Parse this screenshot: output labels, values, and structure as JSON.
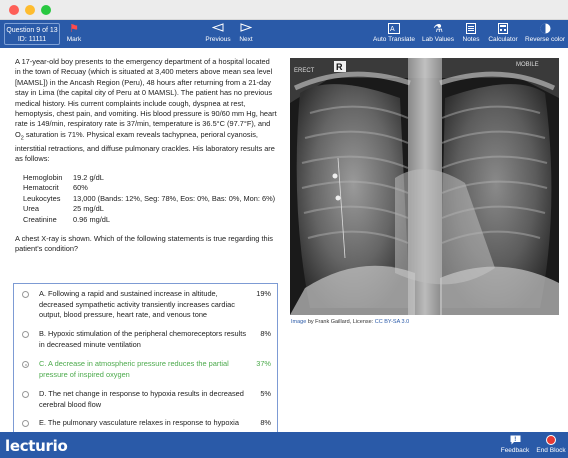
{
  "topbar": {
    "question_label": "Question 9 of 13",
    "id_label": "ID: 11111",
    "mark": "Mark",
    "prev": "Previous",
    "next": "Next",
    "auto_translate": "Auto Translate",
    "lab_values": "Lab Values",
    "notes": "Notes",
    "calculator": "Calculator",
    "reverse_color": "Reverse color"
  },
  "question": {
    "paragraph1": "A 17-year-old boy presents to the emergency department of a hospital located in the town of Recuay (which is situated at 3,400 meters above mean sea level [MAMSL]) in the Ancash Region (Peru), 48 hours after returning from a 21-day stay in Lima (the capital city of Peru at 0 MAMSL). The patient has no previous medical history. His current complaints include cough, dyspnea at rest, hemoptysis, chest pain, and vomiting. His blood pressure is 90/60 mm Hg, heart rate is 149/min, respiratory rate is 37/min, temperature is 36.5°C (97.7°F), and O",
    "o2_sub": "2",
    "paragraph1_end": " saturation is 71%. Physical exam reveals tachypnea, perioral cyanosis, interstitial retractions, and diffuse pulmonary crackles. His laboratory results are as follows:",
    "labs": [
      {
        "k": "Hemoglobin",
        "v": "19.2 g/dL"
      },
      {
        "k": "Hematocrit",
        "v": "60%"
      },
      {
        "k": "Leukocytes",
        "v": "13,000 (Bands: 12%, Seg: 78%, Eos: 0%, Bas: 0%, Mon: 6%)"
      },
      {
        "k": "Urea",
        "v": "25 mg/dL"
      },
      {
        "k": "Creatinine",
        "v": "0.96 mg/dL"
      }
    ],
    "stem": "A chest X-ray is shown. Which of the following statements is true regarding this patient's condition?"
  },
  "answers": [
    {
      "text": "A. Following a rapid and sustained increase in altitude, decreased sympathetic activity transiently increases cardiac output, blood pressure, heart rate, and venous tone",
      "pct": "19%"
    },
    {
      "text": "B. Hypoxic stimulation of the peripheral chemoreceptors results in decreased minute ventilation",
      "pct": "8%"
    },
    {
      "text": "C. A decrease in atmospheric pressure reduces the partial pressure of inspired oxygen",
      "pct": "37%"
    },
    {
      "text": "D. The net change in response to hypoxia results in decreased cerebral blood flow",
      "pct": "5%"
    },
    {
      "text": "E. The pulmonary vasculature relaxes in response to hypoxia",
      "pct": "8%"
    }
  ],
  "xray": {
    "label_left": "ERECT",
    "label_right": "MOBILE",
    "marker": "R"
  },
  "credit": {
    "image": "Image",
    "by": " by Frank Gaillard, License: ",
    "license": "CC BY-SA 3.0"
  },
  "bottombar": {
    "logo": "lecturio",
    "feedback": "Feedback",
    "end_block": "End Block"
  },
  "colors": {
    "bar": "#2a5aa8",
    "correct": "#4caa4c",
    "end_block": "#e53935"
  }
}
